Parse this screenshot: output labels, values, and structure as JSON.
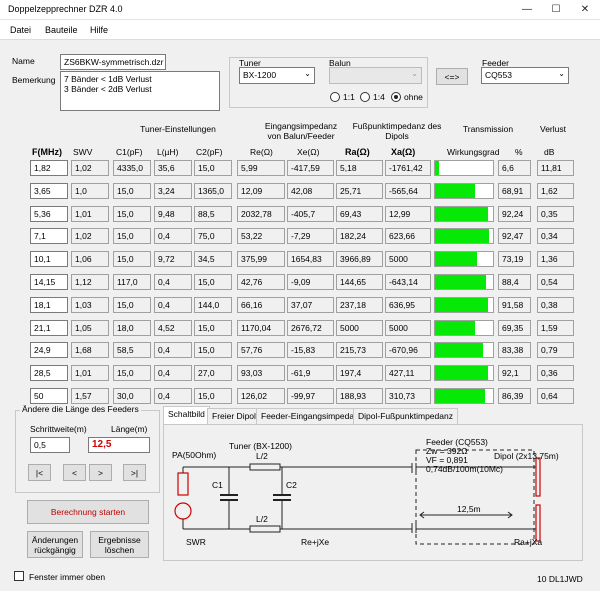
{
  "window": {
    "title": "Doppelzepprechner DZR 4.0",
    "min": "—",
    "max": "☐",
    "close": "✕"
  },
  "menu": [
    "Datei",
    "Bauteile",
    "Hilfe"
  ],
  "file": {
    "name_label": "Name",
    "name_value": "ZS6BKW-symmetrisch.dzr",
    "remark_label": "Bemerkung",
    "remark_line1": "7 Bänder < 1dB Verlust",
    "remark_line2": "3 Bänder < 2dB Verlust"
  },
  "tuner": {
    "label": "Tuner",
    "value": "BX-1200"
  },
  "balun": {
    "label": "Balun",
    "value": "",
    "options": [
      "1:1",
      "1:4",
      "ohne"
    ],
    "selected": 2
  },
  "swap_button": "<=>",
  "feeder": {
    "label": "Feeder",
    "value": "CQ553"
  },
  "groups": {
    "tuner": "Tuner-Einstellungen",
    "input_imp_l1": "Eingangsimpedanz",
    "input_imp_l2": "von Balun/Feeder",
    "feed_imp_l1": "Fußpunktimpedanz des",
    "feed_imp_l2": "Dipols",
    "transmission": "Transmission",
    "loss": "Verlust"
  },
  "columns": {
    "f": "F(MHz)",
    "swv": "SWV",
    "c1": "C1(pF)",
    "l": "L(µH)",
    "c2": "C2(pF)",
    "re": "Re(Ω)",
    "xe": "Xe(Ω)",
    "ra": "Ra(Ω)",
    "xa": "Xa(Ω)",
    "wg": "Wirkungsgrad",
    "pct": "%",
    "db": "dB"
  },
  "rows": [
    {
      "f": "1,82",
      "swv": "1,02",
      "c1": "4335,0",
      "l": "35,6",
      "c2": "15,0",
      "re": "5,99",
      "xe": "-417,59",
      "ra": "5,18",
      "xa": "-1761,42",
      "eff": 6.6,
      "pct": "6,6",
      "db": "11,81"
    },
    {
      "f": "3,65",
      "swv": "1,0",
      "c1": "15,0",
      "l": "3,24",
      "c2": "1365,0",
      "re": "12,09",
      "xe": "42,08",
      "ra": "25,71",
      "xa": "-565,64",
      "eff": 68.91,
      "pct": "68,91",
      "db": "1,62"
    },
    {
      "f": "5,36",
      "swv": "1,01",
      "c1": "15,0",
      "l": "9,48",
      "c2": "88,5",
      "re": "2032,78",
      "xe": "-405,7",
      "ra": "69,43",
      "xa": "12,99",
      "eff": 92.24,
      "pct": "92,24",
      "db": "0,35"
    },
    {
      "f": "7,1",
      "swv": "1,02",
      "c1": "15,0",
      "l": "0,4",
      "c2": "75,0",
      "re": "53,22",
      "xe": "-7,29",
      "ra": "182,24",
      "xa": "623,66",
      "eff": 92.47,
      "pct": "92,47",
      "db": "0,34"
    },
    {
      "f": "10,1",
      "swv": "1,06",
      "c1": "15,0",
      "l": "9,72",
      "c2": "34,5",
      "re": "375,99",
      "xe": "1654,83",
      "ra": "3966,89",
      "xa": "5000",
      "eff": 73.19,
      "pct": "73,19",
      "db": "1,36"
    },
    {
      "f": "14,15",
      "swv": "1,12",
      "c1": "117,0",
      "l": "0,4",
      "c2": "15,0",
      "re": "42,76",
      "xe": "-9,09",
      "ra": "144,65",
      "xa": "-643,14",
      "eff": 88.4,
      "pct": "88,4",
      "db": "0,54"
    },
    {
      "f": "18,1",
      "swv": "1,03",
      "c1": "15,0",
      "l": "0,4",
      "c2": "144,0",
      "re": "66,16",
      "xe": "37,07",
      "ra": "237,18",
      "xa": "636,95",
      "eff": 91.58,
      "pct": "91,58",
      "db": "0,38"
    },
    {
      "f": "21,1",
      "swv": "1,05",
      "c1": "18,0",
      "l": "4,52",
      "c2": "15,0",
      "re": "1170,04",
      "xe": "2676,72",
      "ra": "5000",
      "xa": "5000",
      "eff": 69.35,
      "pct": "69,35",
      "db": "1,59"
    },
    {
      "f": "24,9",
      "swv": "1,68",
      "c1": "58,5",
      "l": "0,4",
      "c2": "15,0",
      "re": "57,76",
      "xe": "-15,83",
      "ra": "215,73",
      "xa": "-670,96",
      "eff": 83.38,
      "pct": "83,38",
      "db": "0,79"
    },
    {
      "f": "28,5",
      "swv": "1,01",
      "c1": "15,0",
      "l": "0,4",
      "c2": "27,0",
      "re": "93,03",
      "xe": "-61,9",
      "ra": "197,4",
      "xa": "427,11",
      "eff": 92.1,
      "pct": "92,1",
      "db": "0,36"
    },
    {
      "f": "50",
      "swv": "1,57",
      "c1": "30,0",
      "l": "0,4",
      "c2": "15,0",
      "re": "126,02",
      "xe": "-99,97",
      "ra": "188,93",
      "xa": "310,73",
      "eff": 86.39,
      "pct": "86,39",
      "db": "0,64"
    }
  ],
  "length": {
    "group": "Ändere die Länge des Feeders",
    "step_label": "Schrittweite(m)",
    "step_value": "0,5",
    "len_label": "Länge(m)",
    "len_value": "12,5",
    "nav": [
      "|<",
      "<",
      ">",
      ">|"
    ]
  },
  "buttons": {
    "start": "Berechnung starten",
    "undo_l1": "Änderungen",
    "undo_l2": "rückgängig",
    "clear_l1": "Ergebnisse",
    "clear_l2": "löschen"
  },
  "tabs": [
    "Schaltbild",
    "Freier Dipol",
    "Feeder-Eingangsimpedanz",
    "Dipol-Fußpunktimpedanz"
  ],
  "schematic": {
    "pa": "PA(50Ohm)",
    "tuner": "Tuner (BX-1200)",
    "l2a": "L/2",
    "l2b": "L/2",
    "c1": "C1",
    "c2": "C2",
    "swr": "SWR",
    "rexe": "Re+jXe",
    "feeder1": "Feeder (CQ553)",
    "feeder2": "Zw = 392Ω",
    "feeder3": "VF = 0,891",
    "feeder4": "0,74dB/100m(10Mc)",
    "dipol": "Dipol (2x13,75m)",
    "len": "12,5m",
    "raxa": "Ra+jXa"
  },
  "footer": {
    "checkbox": "Fenster immer oben",
    "version": "10 DL1JWD"
  },
  "colors": {
    "bar": "#06e806",
    "start_text": "#c00000",
    "length_text": "#d00000"
  }
}
